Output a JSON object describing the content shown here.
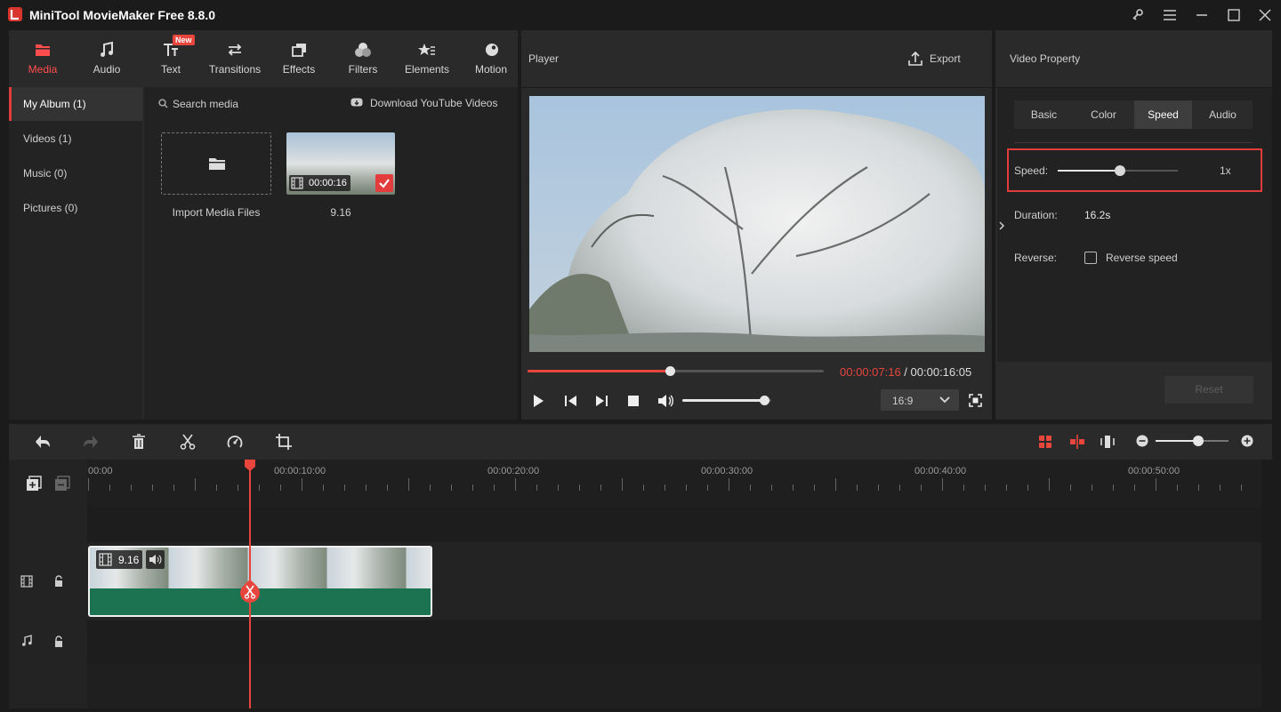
{
  "window": {
    "title": "MiniTool MovieMaker Free 8.8.0"
  },
  "toolbar": {
    "tools": [
      {
        "label": "Media",
        "icon": "media-icon",
        "active": true
      },
      {
        "label": "Audio",
        "icon": "music-note-icon"
      },
      {
        "label": "Text",
        "icon": "text-icon",
        "badge": "New"
      },
      {
        "label": "Transitions",
        "icon": "transitions-icon"
      },
      {
        "label": "Effects",
        "icon": "effects-icon"
      },
      {
        "label": "Filters",
        "icon": "filters-icon"
      },
      {
        "label": "Elements",
        "icon": "elements-icon"
      },
      {
        "label": "Motion",
        "icon": "motion-icon"
      }
    ]
  },
  "sidebar": {
    "items": [
      {
        "label": "My Album (1)",
        "active": true
      },
      {
        "label": "Videos (1)"
      },
      {
        "label": "Music (0)"
      },
      {
        "label": "Pictures (0)"
      }
    ]
  },
  "media": {
    "search_label": "Search media",
    "download_label": "Download YouTube Videos",
    "import_label": "Import Media Files",
    "clip": {
      "duration": "00:00:16",
      "name": "9.16"
    }
  },
  "player": {
    "title": "Player",
    "export_label": "Export",
    "current_time": "00:00:07:16",
    "separator": " / ",
    "total_time": "00:00:16:05",
    "progress": 0.48,
    "volume": 0.92,
    "aspect_ratio": "16:9"
  },
  "property": {
    "title": "Video Property",
    "tabs": [
      {
        "label": "Basic"
      },
      {
        "label": "Color"
      },
      {
        "label": "Speed",
        "active": true
      },
      {
        "label": "Audio"
      }
    ],
    "speed_label": "Speed:",
    "speed_value": "1x",
    "speed_slider": 0.52,
    "duration_label": "Duration:",
    "duration_value": "16.2s",
    "reverse_label": "Reverse:",
    "reverse_checkbox_label": "Reverse speed",
    "reset_label": "Reset"
  },
  "timeline": {
    "ruler_labels": [
      "00:00",
      "00:00:10:00",
      "00:00:20:00",
      "00:00:30:00",
      "00:00:40:00",
      "00:00:50:00"
    ],
    "clip": {
      "name": "9.16"
    },
    "zoom": 0.58
  },
  "colors": {
    "accent": "#e8463c",
    "clip_green": "#1b7351",
    "panel": "#2a2a2a",
    "highlight_box": "#e23c3c"
  }
}
